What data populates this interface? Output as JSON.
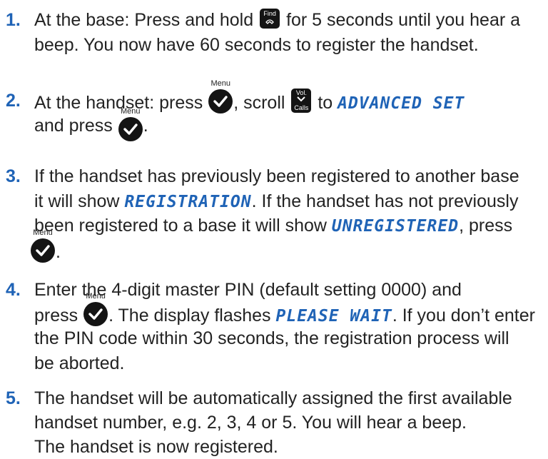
{
  "colors": {
    "accent": "#1f63b6",
    "text": "#232323",
    "key": "#141414"
  },
  "keys": {
    "menu": "Menu",
    "find": "Find",
    "vol": "Vol.",
    "calls": "Calls"
  },
  "steps": [
    {
      "number": "1.",
      "line1_a": "At the base: Press and hold",
      "line1_b": "for 5 seconds until you hear a",
      "line2": "beep. You now have 60 seconds to register the handset."
    },
    {
      "number": "2.",
      "line1_a": "At the handset: press",
      "line1_b": ", scroll",
      "line1_c": "to",
      "display1": "ADVANCED SET",
      "line2_a": "and press",
      "line2_b": "."
    },
    {
      "number": "3.",
      "line1": "If the handset has previously been registered to another base",
      "line2_a": "it will show",
      "display1": "REGISTRATION",
      "line2_b": ". If the handset has not previously",
      "line3_a": "been registered to a base it will show",
      "display2": "UNREGISTERED",
      "line3_b": ", press",
      "line4_b": "."
    },
    {
      "number": "4.",
      "line1": "Enter the 4-digit master PIN (default setting 0000) and",
      "line2_a": "press",
      "line2_b": ". The display flashes",
      "display1": "PLEASE WAIT",
      "line2_c": ". If you don’t enter",
      "line3": "the PIN code within 30 seconds, the registration process will",
      "line4": "be aborted."
    },
    {
      "number": "5.",
      "line1": "The handset will be automatically assigned the first available",
      "line2": "handset number, e.g. 2, 3, 4 or 5. You will hear a beep.",
      "line3": "The handset is now registered."
    }
  ]
}
